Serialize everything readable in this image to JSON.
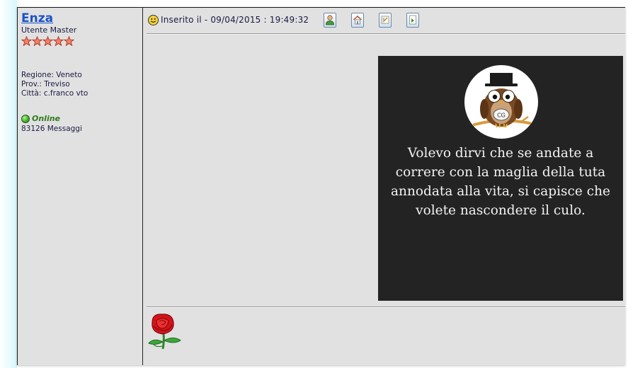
{
  "user": {
    "name": "Enza",
    "rank": "Utente Master",
    "star_count": 5,
    "region": "Regione: Veneto",
    "province": "Prov.: Treviso",
    "city": "Città: c.franco vto",
    "status": "Online",
    "messages": "83126 Messaggi"
  },
  "post": {
    "posted_label": "Inserito il -  09/04/2015 :  19:49:32",
    "toolbar_icons": [
      "profile-icon",
      "home-icon",
      "quote-icon",
      "bookmark-icon"
    ],
    "image": {
      "quote_text": "Volevo dirvi che se andate a correre con la maglia della tuta annodata alla vita, si capisce che volete nascondere il culo."
    },
    "signature_icon": "rose-icon"
  },
  "colors": {
    "username": "#1a52c8",
    "background": "#e1e1e1",
    "online": "#2f7a1e",
    "image_bg": "#232323",
    "star": "#e8624a"
  }
}
